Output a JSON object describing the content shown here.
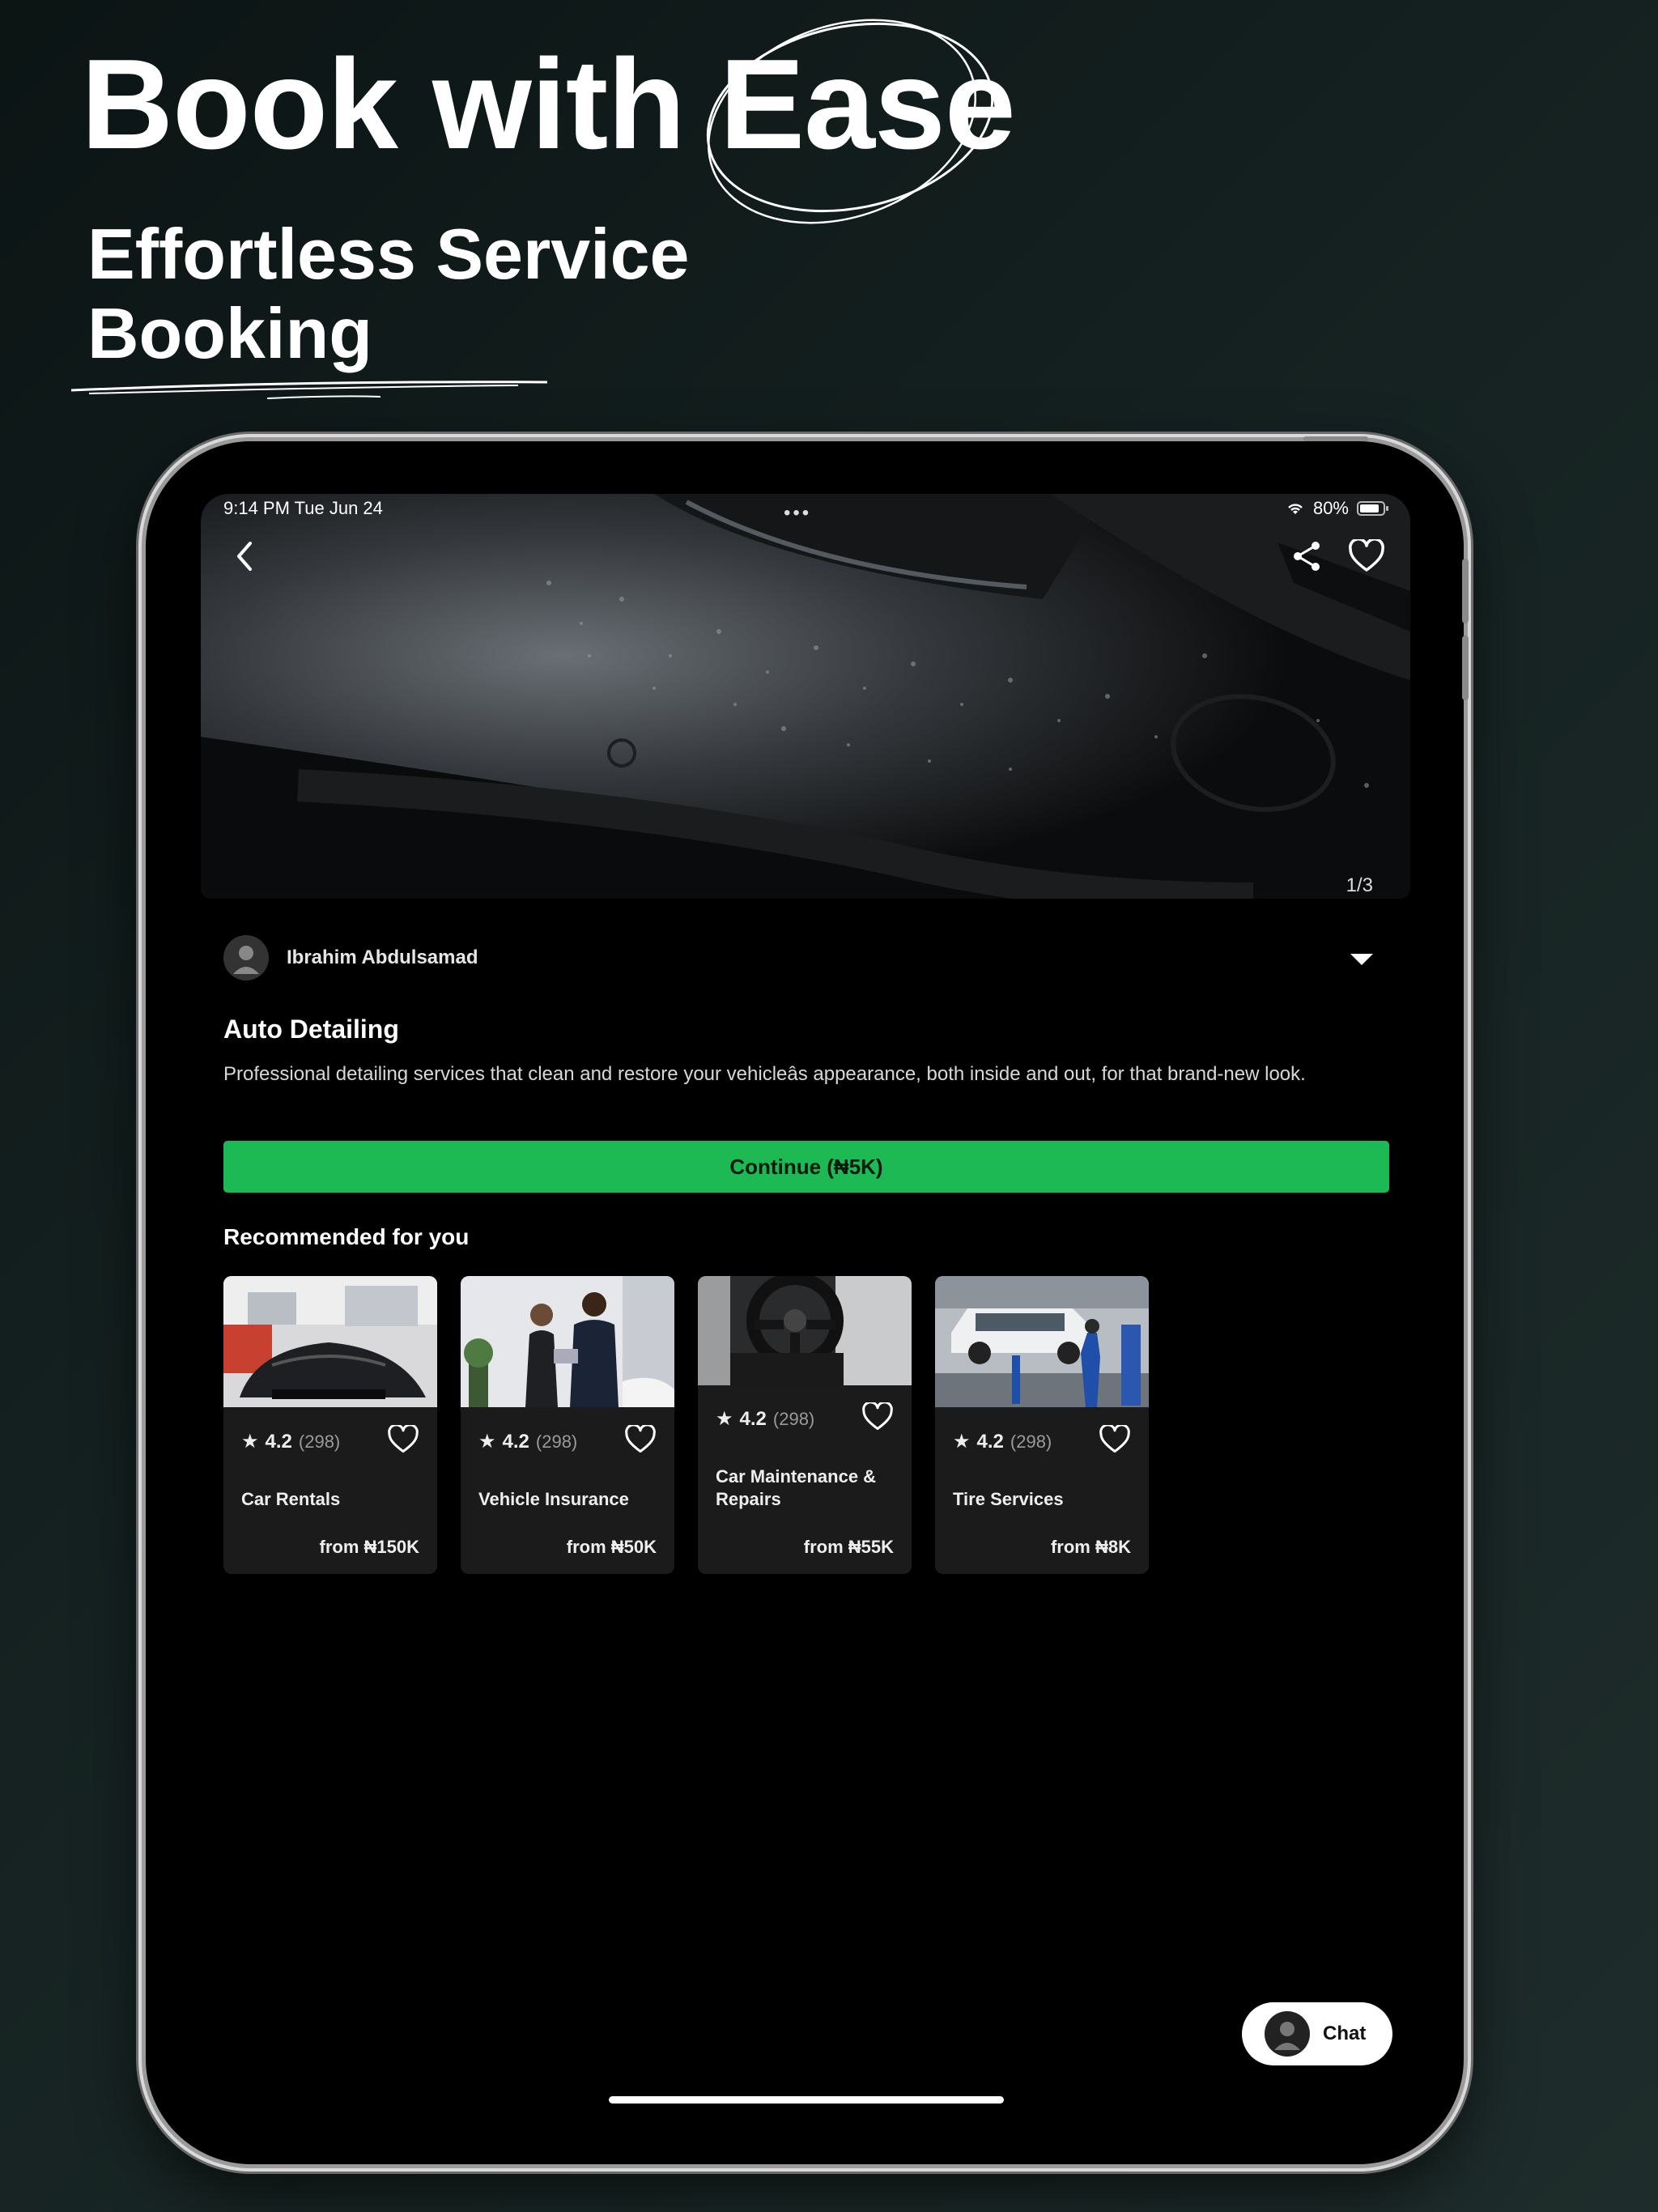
{
  "marketing": {
    "headline": "Book with Ease",
    "subheadline": "Effortless Service Booking"
  },
  "status_bar": {
    "time": "9:14 PM   Tue Jun 24",
    "battery": "80%",
    "wifi_icon": "wifi-icon",
    "battery_icon": "battery-icon"
  },
  "hero": {
    "image_counter": "1/3",
    "back_icon": "chevron-left-icon",
    "share_icon": "share-icon",
    "favorite_icon": "heart-icon"
  },
  "owner": {
    "name": "Ibrahim Abdulsamad"
  },
  "service": {
    "title": "Auto Detailing",
    "description": "Professional detailing services that clean and restore your vehicleâs appearance, both inside and out, for that brand-new look.",
    "cta_label": "Continue (₦5K)"
  },
  "recommended": {
    "title": "Recommended for you",
    "items": [
      {
        "rating": "4.2",
        "count": "(298)",
        "name": "Car Rentals",
        "price": "from ₦150K"
      },
      {
        "rating": "4.2",
        "count": "(298)",
        "name": "Vehicle Insurance",
        "price": "from ₦50K"
      },
      {
        "rating": "4.2",
        "count": "(298)",
        "name": "Car Maintenance & Repairs",
        "price": "from ₦55K"
      },
      {
        "rating": "4.2",
        "count": "(298)",
        "name": "Tire Services",
        "price": "from ₦8K"
      }
    ]
  },
  "chat": {
    "label": "Chat"
  },
  "colors": {
    "accent_green": "#1db954",
    "background": "#000000",
    "card": "#1b1b1b"
  }
}
